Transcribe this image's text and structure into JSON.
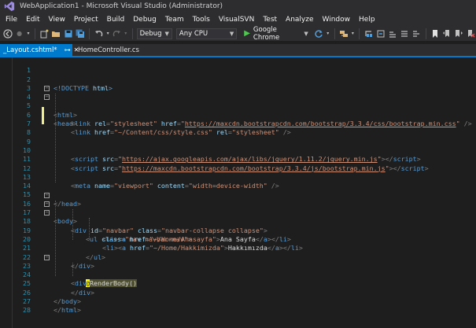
{
  "window": {
    "title": "WebApplication1 - Microsoft Visual Studio (Administrator)"
  },
  "menu": [
    "File",
    "Edit",
    "View",
    "Project",
    "Build",
    "Debug",
    "Team",
    "Tools",
    "VisualSVN",
    "Test",
    "Analyze",
    "Window",
    "Help"
  ],
  "toolbar": {
    "config": "Debug",
    "platform": "Any CPU",
    "run_target": "Google Chrome"
  },
  "tabs": [
    {
      "label": "_Layout.cshtml*",
      "active": true
    },
    {
      "label": "HomeController.cs",
      "active": false
    }
  ],
  "editor": {
    "line_numbers": [
      "1",
      "2",
      "3",
      "4",
      "5",
      "6",
      "7",
      "8",
      "9",
      "10",
      "11",
      "12",
      "13",
      "14",
      "15",
      "16",
      "17",
      "18",
      "19",
      "20",
      "21",
      "22",
      "23",
      "24",
      "25",
      "26",
      "27",
      "28"
    ],
    "lines": {
      "l2": {
        "t1": "<!DOCTYPE",
        "t2": " html",
        "t3": ">"
      },
      "l4": {
        "t1": "<",
        "t2": "html",
        "t3": ">"
      },
      "l5": {
        "t1": "<",
        "t2": "head",
        "t3": ">"
      },
      "l6": {
        "t1": "<",
        "t2": "link",
        "t3": " rel",
        "t4": "=",
        "t5": "\"stylesheet\"",
        "t6": " href",
        "t7": "=",
        "t8": "\"",
        "t9": "https://maxcdn.bootstrapcdn.com/bootstrap/3.3.4/css/bootstrap.min.css",
        "t10": "\"",
        "t11": " />"
      },
      "l7": {
        "t1": "<",
        "t2": "link",
        "t3": " href",
        "t4": "=",
        "t5": "\"~/Content/css/style.css\"",
        "t6": " rel",
        "t7": "=",
        "t8": "\"stylesheet\"",
        "t9": " />"
      },
      "l10": {
        "t1": "<",
        "t2": "script",
        "t3": " src",
        "t4": "=",
        "t5": "\"",
        "t6": "https://ajax.googleapis.com/ajax/libs/jquery/1.11.2/jquery.min.js",
        "t7": "\"",
        "t8": "></",
        "t9": "script",
        "t10": ">"
      },
      "l11": {
        "t1": "<",
        "t2": "script",
        "t3": " src",
        "t4": "=",
        "t5": "\"",
        "t6": "https://maxcdn.bootstrapcdn.com/bootstrap/3.3.4/js/bootstrap.min.js",
        "t7": "\"",
        "t8": "></",
        "t9": "script",
        "t10": ">"
      },
      "l13": {
        "t1": "<",
        "t2": "meta",
        "t3": " name",
        "t4": "=",
        "t5": "\"viewport\"",
        "t6": " content",
        "t7": "=",
        "t8": "\"width=device-width\"",
        "t9": " />"
      },
      "l15": {
        "t1": "</",
        "t2": "head",
        "t3": ">"
      },
      "l16": {
        "t1": "<",
        "t2": "body",
        "t3": ">"
      },
      "l17": {
        "t1": "<",
        "t2": "div",
        "t3": " id",
        "t4": "=",
        "t5": "\"navbar\"",
        "t6": " class",
        "t7": "=",
        "t8": "\"navbar-collapse collapse\"",
        "t9": ">"
      },
      "l18": {
        "t1": "<",
        "t2": "ul",
        "t3": " class",
        "t4": "=",
        "t5": "\"nav navbar-nav\"",
        "t6": ">"
      },
      "l19": {
        "t1": "<",
        "t2": "li",
        "t3": "><",
        "t4": "a",
        "t5": " href",
        "t6": "=",
        "t7": "\"~/Home/Anasayfa\"",
        "t8": ">",
        "t9": "Ana Sayfa",
        "t10": "</",
        "t11": "a",
        "t12": "></",
        "t13": "li",
        "t14": ">"
      },
      "l20": {
        "t1": "<",
        "t2": "li",
        "t3": "><",
        "t4": "a",
        "t5": " href",
        "t6": "=",
        "t7": "\"~/Home/Hakkimizda\"",
        "t8": ">",
        "t9": "Hakkımızda",
        "t10": "</",
        "t11": "a",
        "t12": "></",
        "t13": "li",
        "t14": ">"
      },
      "l21": {
        "t1": "</",
        "t2": "ul",
        "t3": ">"
      },
      "l22": {
        "t1": "</",
        "t2": "div",
        "t3": ">"
      },
      "l23": {
        "t1": "<",
        "t2": "div",
        "t3": ">"
      },
      "l24": {
        "t1": "@",
        "t2": "RenderBody()"
      },
      "l25": {
        "t1": "</",
        "t2": "div",
        "t3": ">"
      },
      "l26": {
        "t1": "</",
        "t2": "body",
        "t3": ">"
      },
      "l27": {
        "t1": "</",
        "t2": "html",
        "t3": ">"
      }
    }
  },
  "colors": {
    "accent": "#007acc",
    "tag": "#569cd6",
    "attribute": "#9cdcfe",
    "string": "#ce9178",
    "line_number": "#2b91af",
    "change_marker": "#efef8f"
  }
}
